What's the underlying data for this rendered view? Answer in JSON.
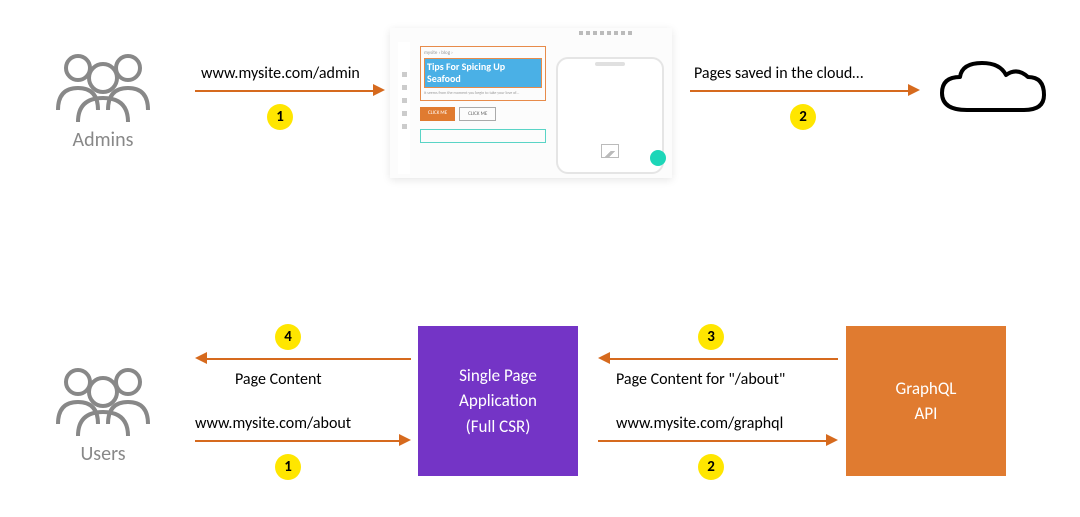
{
  "actors": {
    "admins_label": "Admins",
    "users_label": "Users"
  },
  "editor_mock": {
    "headline": "Tips For Spicing Up Seafood",
    "breadcrumb": "mysite › blog ›",
    "paragraph": "It seems from the moment you begin to take your love of…",
    "btn_primary": "CLICK ME",
    "btn_secondary": "CLICK ME"
  },
  "spa_box": {
    "line1": "Single Page",
    "line2": "Application",
    "line3": "(Full CSR)"
  },
  "graphql_box": {
    "line1": "GraphQL",
    "line2": "API"
  },
  "top_flow": {
    "arrow1": {
      "step": "1",
      "label": "www.mysite.com/admin"
    },
    "arrow2": {
      "step": "2",
      "label": "Pages saved in the cloud…"
    }
  },
  "bottom_flow": {
    "arrow1": {
      "step": "1",
      "label": "www.mysite.com/about"
    },
    "arrow2": {
      "step": "2",
      "label": "www.mysite.com/graphql"
    },
    "arrow3": {
      "step": "3",
      "label": "Page Content for \"/about\""
    },
    "arrow4": {
      "step": "4",
      "label": "Page Content"
    }
  },
  "colors": {
    "arrow": "#d66a1e",
    "badge": "#ffe600",
    "spa": "#7434c6",
    "graphql": "#e07b30"
  }
}
